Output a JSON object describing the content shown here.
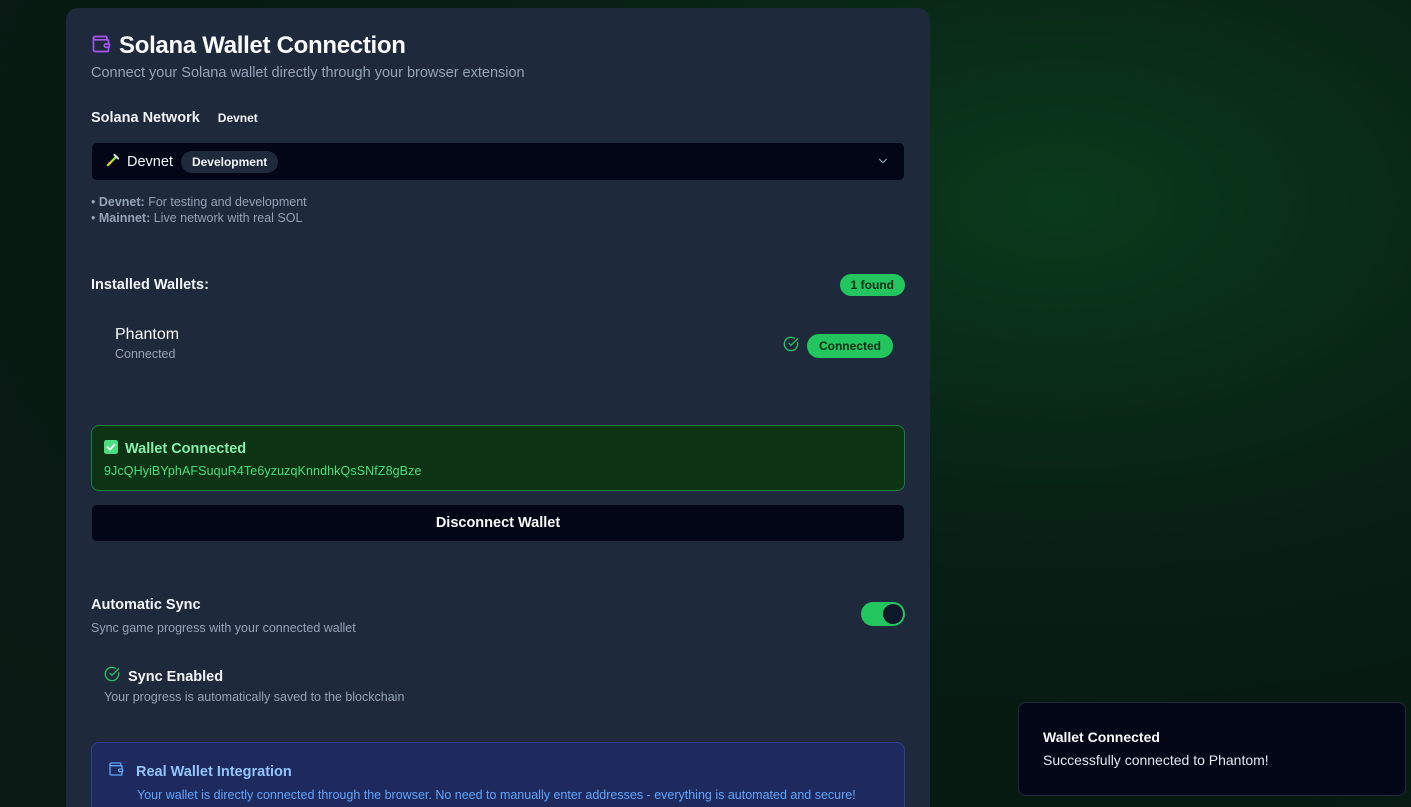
{
  "header": {
    "title": "Solana Wallet Connection",
    "subtitle": "Connect your Solana wallet directly through your browser extension"
  },
  "network": {
    "label": "Solana Network",
    "badge": "Devnet",
    "selected_value": "Devnet",
    "selected_tag": "Development",
    "notes": [
      {
        "name": "Devnet:",
        "text": "For testing and development"
      },
      {
        "name": "Mainnet:",
        "text": "Live network with real SOL"
      }
    ]
  },
  "wallets": {
    "label": "Installed Wallets:",
    "found_badge": "1 found",
    "items": [
      {
        "name": "Phantom",
        "status": "Connected",
        "pill": "Connected"
      }
    ]
  },
  "connection": {
    "title": "Wallet Connected",
    "address": "9JcQHyiBYphAFSuquR4Te6yzuzqKnndhkQsSNfZ8gBze",
    "disconnect_label": "Disconnect Wallet"
  },
  "sync": {
    "label": "Automatic Sync",
    "description": "Sync game progress with your connected wallet",
    "enabled": true,
    "status_title": "Sync Enabled",
    "status_desc": "Your progress is automatically saved to the blockchain"
  },
  "info": {
    "title": "Real Wallet Integration",
    "description": "Your wallet is directly connected through the browser. No need to manually enter addresses - everything is automated and secure!"
  },
  "toast": {
    "title": "Wallet Connected",
    "description": "Successfully connected to Phantom!"
  },
  "colors": {
    "accent_green": "#22c55e",
    "brand_purple": "#a855f7",
    "info_blue": "#60a5fa"
  }
}
